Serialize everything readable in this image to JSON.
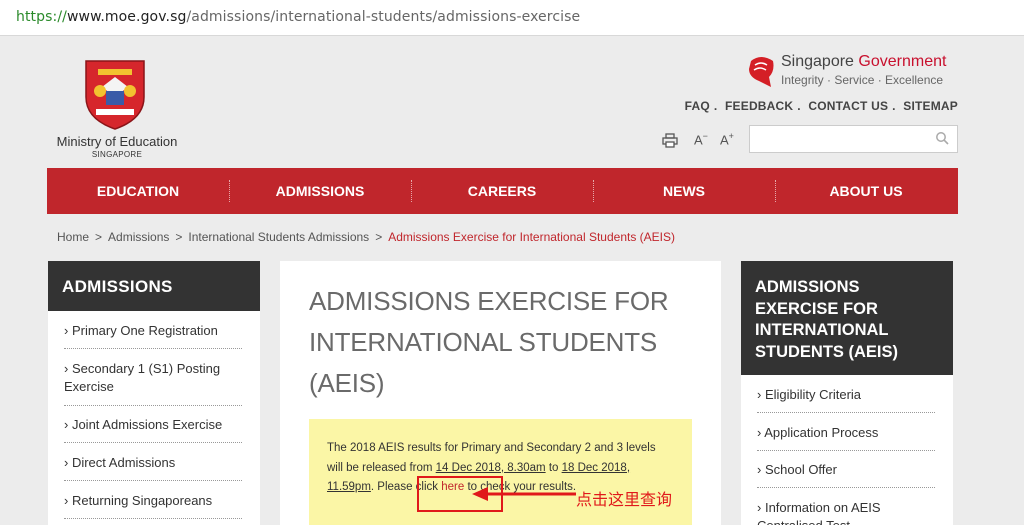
{
  "browser": {
    "url_protocol": "https://",
    "url_host": "www.moe.gov.sg",
    "url_path": "/admissions/international-students/admissions-exercise"
  },
  "header": {
    "ministry_name": "Ministry of Education",
    "ministry_sub": "SINGAPORE",
    "gov_brand_prefix": "Singapore",
    "gov_brand_highlight": "Government",
    "gov_tagline": "Integrity · Service · Excellence",
    "top_links": [
      "FAQ",
      "FEEDBACK",
      "CONTACT US",
      "SITEMAP"
    ],
    "font_decrease": "A",
    "font_increase": "A"
  },
  "nav": {
    "items": [
      "EDUCATION",
      "ADMISSIONS",
      "CAREERS",
      "NEWS",
      "ABOUT US"
    ]
  },
  "breadcrumb": {
    "items": [
      "Home",
      "Admissions",
      "International Students Admissions"
    ],
    "current": "Admissions Exercise for International Students (AEIS)",
    "separator": ">"
  },
  "left_sidebar": {
    "title": "ADMISSIONS",
    "items": [
      "Primary One Registration",
      "Secondary 1 (S1) Posting Exercise",
      "Joint Admissions Exercise",
      "Direct Admissions",
      "Returning Singaporeans"
    ]
  },
  "main": {
    "title": "ADMISSIONS EXERCISE FOR INTERNATIONAL STUDENTS (AEIS)",
    "notice": {
      "part1": "The 2018 AEIS results for Primary and Secondary 2 and 3 levels will be released from ",
      "date1": "14 Dec 2018, 8.30am",
      "part2": " to ",
      "date2": "18 Dec 2018, 11.59pm",
      "part3": ". Please click ",
      "link": "here",
      "part4": " to check your results."
    }
  },
  "right_sidebar": {
    "title": "ADMISSIONS EXERCISE FOR INTERNATIONAL STUDENTS (AEIS)",
    "items": [
      "Eligibility Criteria",
      "Application Process",
      "School Offer",
      "Information on AEIS Centralised Test"
    ]
  },
  "annotation": {
    "text": "点击这里查询",
    "color": "#e0191b"
  },
  "colors": {
    "brand_red": "#c0262c",
    "dark_panel": "#333333",
    "notice_yellow": "#fbf6a6"
  }
}
